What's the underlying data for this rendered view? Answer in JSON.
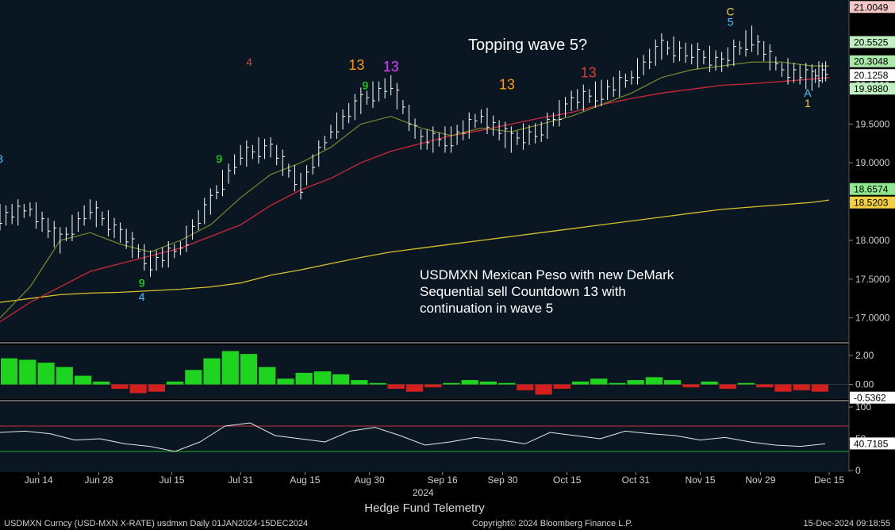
{
  "chart_data": {
    "type": "line",
    "ticker": "USDMXN",
    "x_ticks": [
      "Jun 14",
      "Jun 28",
      "Jul 15",
      "Jul 31",
      "Aug 15",
      "Aug 30",
      "Sep 16",
      "Sep 30",
      "Oct 15",
      "Oct 31",
      "Nov 15",
      "Nov 29",
      "Dec 15"
    ],
    "year_label": "2024",
    "main_panel": {
      "y_ticks": [
        17.0,
        17.5,
        18.0,
        18.5,
        19.0,
        19.5,
        20.0
      ],
      "ylim": [
        16.7,
        21.1
      ],
      "price_dates": [
        "2024-06-05",
        "2024-06-12",
        "2024-06-19",
        "2024-06-26",
        "2024-07-03",
        "2024-07-10",
        "2024-07-17",
        "2024-07-24",
        "2024-07-31",
        "2024-08-07",
        "2024-08-14",
        "2024-08-21",
        "2024-08-28",
        "2024-09-04",
        "2024-09-11",
        "2024-09-18",
        "2024-09-25",
        "2024-10-02",
        "2024-10-09",
        "2024-10-16",
        "2024-10-23",
        "2024-10-30",
        "2024-11-06",
        "2024-11-13",
        "2024-11-20",
        "2024-11-27",
        "2024-12-04",
        "2024-12-11",
        "2024-12-15"
      ],
      "price": [
        18.3,
        18.4,
        18.0,
        18.4,
        18.1,
        17.7,
        17.9,
        18.5,
        19.1,
        19.2,
        18.7,
        19.4,
        19.8,
        20.0,
        19.3,
        19.3,
        19.6,
        19.3,
        19.4,
        19.8,
        19.9,
        20.1,
        20.5,
        20.4,
        20.3,
        20.6,
        20.2,
        20.1,
        20.2
      ],
      "ma_green": [
        17.0,
        17.4,
        18.0,
        18.1,
        17.95,
        17.85,
        18.0,
        18.2,
        18.55,
        18.85,
        19.0,
        19.2,
        19.5,
        19.6,
        19.45,
        19.35,
        19.45,
        19.4,
        19.5,
        19.6,
        19.75,
        19.9,
        20.1,
        20.2,
        20.25,
        20.3,
        20.3,
        20.25,
        20.25
      ],
      "ma_red": [
        16.95,
        17.2,
        17.4,
        17.6,
        17.7,
        17.8,
        17.9,
        18.05,
        18.2,
        18.45,
        18.65,
        18.8,
        19.0,
        19.15,
        19.25,
        19.35,
        19.42,
        19.5,
        19.58,
        19.65,
        19.75,
        19.83,
        19.9,
        19.95,
        20.0,
        20.02,
        20.05,
        20.08,
        20.1
      ],
      "ma_yellow": [
        17.2,
        17.25,
        17.3,
        17.32,
        17.33,
        17.35,
        17.37,
        17.4,
        17.45,
        17.55,
        17.62,
        17.7,
        17.78,
        17.85,
        17.9,
        17.95,
        18.0,
        18.05,
        18.1,
        18.15,
        18.2,
        18.25,
        18.3,
        18.35,
        18.4,
        18.43,
        18.46,
        18.49,
        18.52
      ],
      "price_labels": [
        {
          "text": "21.0049",
          "bg": "#f7c6c6",
          "fg": "#000000"
        },
        {
          "text": "20.5525",
          "bg": "#bff0bf",
          "fg": "#000000"
        },
        {
          "text": "20.3048",
          "bg": "#a8e8a8",
          "fg": "#000000"
        },
        {
          "text": "20.1258",
          "bg": "#ffffff",
          "fg": "#000000"
        },
        {
          "text": "19.9880",
          "bg": "#bff0bf",
          "fg": "#000000"
        },
        {
          "text": "18.6574",
          "bg": "#8fe88f",
          "fg": "#000000"
        },
        {
          "text": "18.5203",
          "bg": "#f0d040",
          "fg": "#000000"
        }
      ],
      "annotation_title": "Topping wave 5?",
      "annotation_body": [
        "USDMXN Mexican Peso with new DeMark",
        "Sequential sell Countdown 13 with",
        "continuation in wave 5"
      ],
      "demark_counts": [
        {
          "date": "2024-06-05",
          "value": 19.0,
          "text": "3",
          "color": "#4fc3f7"
        },
        {
          "date": "2024-07-08",
          "value": 17.4,
          "text": "9",
          "color": "#1aff1a"
        },
        {
          "date": "2024-07-08",
          "value": 17.22,
          "text": "4",
          "color": "#4fc3f7"
        },
        {
          "date": "2024-07-26",
          "value": 19.0,
          "text": "9",
          "color": "#1aff1a"
        },
        {
          "date": "2024-08-02",
          "value": 20.25,
          "text": "4",
          "color": "#e53935"
        },
        {
          "date": "2024-08-27",
          "value": 20.2,
          "text": "13",
          "color": "#ff9800"
        },
        {
          "date": "2024-09-04",
          "value": 20.18,
          "text": "13",
          "color": "#e040fb"
        },
        {
          "date": "2024-08-29",
          "value": 19.95,
          "text": "9",
          "color": "#1aff1a"
        },
        {
          "date": "2024-10-01",
          "value": 19.95,
          "text": "13",
          "color": "#ff9800"
        },
        {
          "date": "2024-10-20",
          "value": 20.1,
          "text": "13",
          "color": "#e53935"
        },
        {
          "date": "2024-11-22",
          "value": 20.9,
          "text": "C",
          "color": "#f0d040"
        },
        {
          "date": "2024-11-22",
          "value": 20.77,
          "text": "5",
          "color": "#4fc3f7"
        },
        {
          "date": "2024-12-10",
          "value": 19.85,
          "text": "A",
          "color": "#4fc3f7"
        },
        {
          "date": "2024-12-10",
          "value": 19.72,
          "text": "1",
          "color": "#f0d040"
        }
      ]
    },
    "macd_panel": {
      "y_ticks": [
        "2.00",
        "0.00"
      ],
      "ylim": [
        -0.9,
        2.6
      ],
      "current_label": "-0.5362",
      "histogram": [
        1.8,
        1.7,
        1.5,
        1.2,
        0.6,
        0.2,
        -0.3,
        -0.6,
        -0.5,
        0.2,
        1.0,
        1.8,
        2.3,
        2.1,
        1.2,
        0.4,
        0.8,
        0.9,
        0.7,
        0.3,
        0.1,
        -0.3,
        -0.5,
        -0.2,
        0.1,
        0.3,
        0.2,
        0.1,
        -0.4,
        -0.7,
        -0.3,
        0.2,
        0.4,
        0.1,
        0.3,
        0.5,
        0.3,
        -0.2,
        0.2,
        -0.3,
        0.1,
        -0.2,
        -0.5,
        -0.4,
        -0.5
      ]
    },
    "rsi_panel": {
      "y_ticks": [
        100,
        50,
        0
      ],
      "ylim": [
        0,
        105
      ],
      "current_label": "40.7185",
      "rsi": [
        60,
        62,
        58,
        48,
        50,
        42,
        38,
        30,
        45,
        70,
        75,
        55,
        50,
        45,
        62,
        68,
        55,
        40,
        45,
        52,
        48,
        42,
        60,
        55,
        50,
        62,
        58,
        55,
        48,
        52,
        45,
        40,
        38,
        42
      ]
    }
  },
  "footer": {
    "title": "Hedge Fund Telemetry",
    "left": "USDMXN Curncy (USD-MXN X-RATE) usdmxn  Daily 01JAN2024-15DEC2024",
    "middle": "Copyright© 2024 Bloomberg Finance L.P.",
    "right": "15-Dec-2024 09:18:55"
  }
}
